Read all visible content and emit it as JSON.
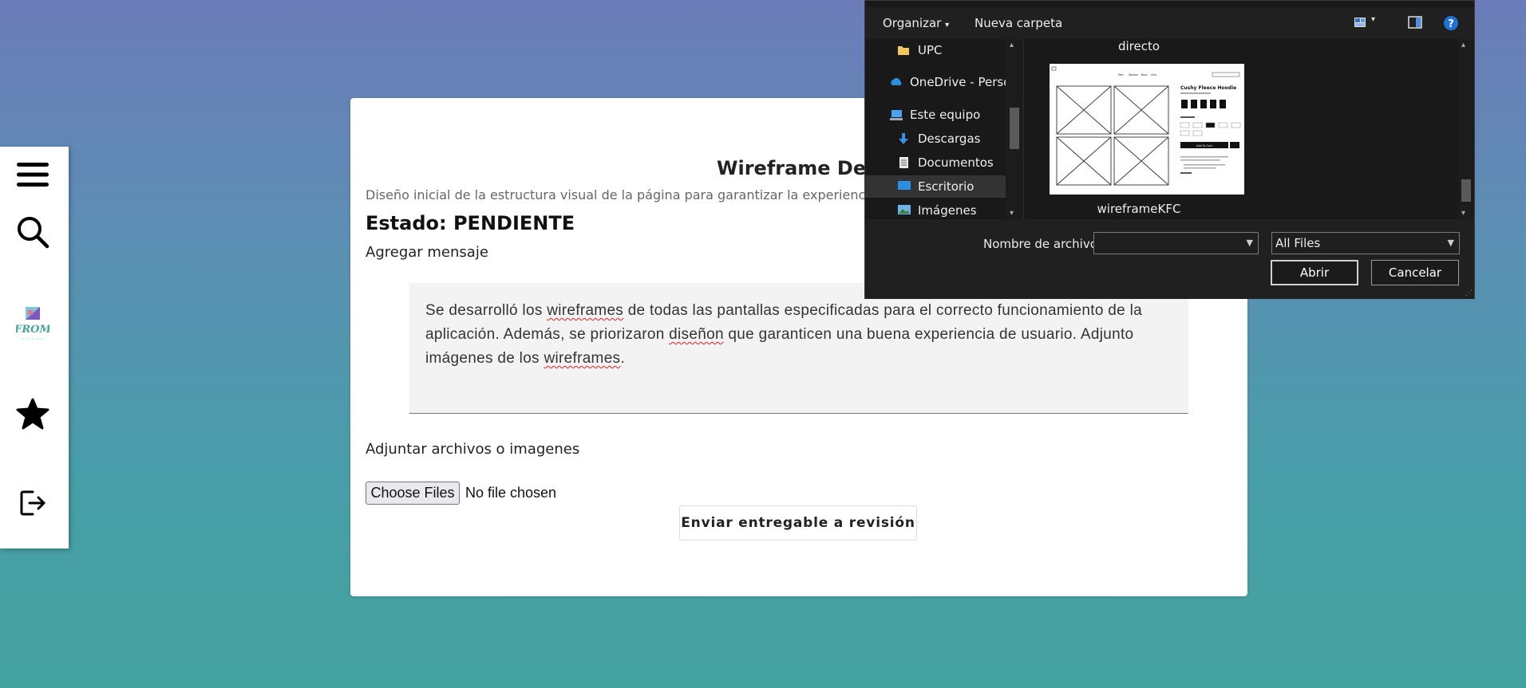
{
  "sidebar": {
    "items": [
      "menu-icon",
      "search-icon",
      "logo",
      "star-icon",
      "logout-icon"
    ],
    "logo_text": "FROM"
  },
  "card": {
    "title": "Wireframe Design",
    "description": "Diseño inicial de la estructura visual de la página para garantizar la experiencia",
    "status": "Estado: PENDIENTE",
    "message_label": "Agregar mensaje",
    "message": {
      "p1": "Se desarrolló los ",
      "w1": "wireframes",
      "p2": " de todas las pantallas especificadas para el correcto funcionamiento de la aplicación. Además, se priorizaron ",
      "w2": "diseñon",
      "p3": " que garanticen una buena experiencia de usuario. Adjunto imágenes de los ",
      "w3": "wireframes",
      "p4": "."
    },
    "attach_label": "Adjuntar archivos o imagenes",
    "choose_files": "Choose Files",
    "no_file": "No file chosen",
    "submit": "Enviar entregable a revisión"
  },
  "dialog": {
    "organize": "Organizar",
    "new_folder": "Nueva carpeta",
    "nav": [
      {
        "label": "UPC",
        "icon": "folder-icon"
      },
      {
        "label": "OneDrive - Person",
        "icon": "onedrive-icon"
      },
      {
        "label": "Este equipo",
        "icon": "computer-icon"
      },
      {
        "label": "Descargas",
        "icon": "download-icon"
      },
      {
        "label": "Documentos",
        "icon": "document-icon"
      },
      {
        "label": "Escritorio",
        "icon": "desktop-icon"
      },
      {
        "label": "Imágenes",
        "icon": "images-icon"
      }
    ],
    "folder_above": "directo",
    "file_name": "wireframeKFC",
    "thumb": {
      "nav": [
        "Men",
        "Women",
        "Boys",
        "Girls"
      ],
      "product": "Cushy Fleece Hoodie",
      "cta": "Add To Cart"
    },
    "filename_label": "Nombre de archivo:",
    "filename_value": "",
    "filter": "All Files",
    "open": "Abrir",
    "cancel": "Cancelar"
  },
  "colors": {
    "bg_top": "#6c7cb9",
    "bg_bottom": "#44a39f",
    "dialog_bg": "#191919",
    "selection": "#333333"
  }
}
